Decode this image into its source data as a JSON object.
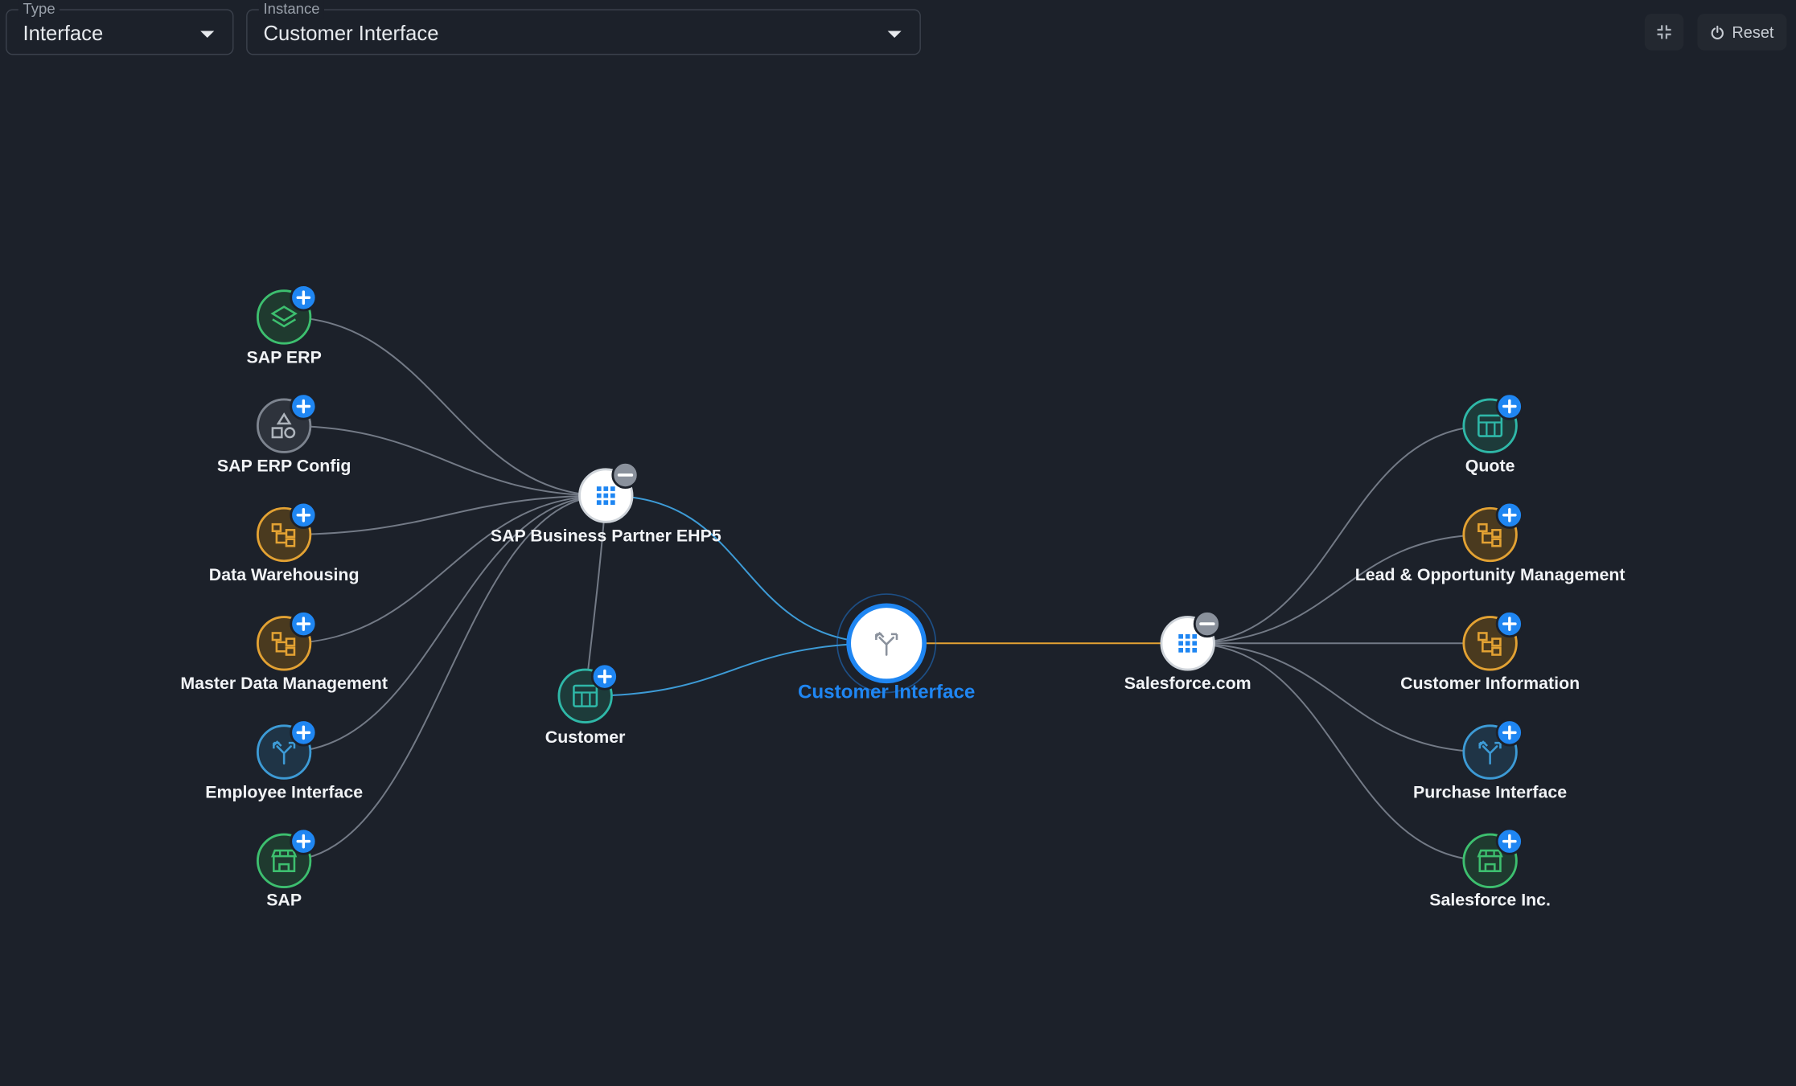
{
  "toolbar": {
    "type_label": "Type",
    "type_value": "Interface",
    "instance_label": "Instance",
    "instance_value": "Customer Interface",
    "collapse_icon": "collapse-icon",
    "reset_label": "Reset",
    "reset_icon": "power-icon"
  },
  "colors": {
    "background": "#1c212a",
    "accent": "#1f86f2",
    "edge_gray": "#737a86",
    "edge_blue": "#3d9bd6",
    "edge_orange": "#e3a233",
    "green": "#3dbf6f",
    "orange": "#e3a233",
    "teal": "#2fb8a8",
    "blue": "#3d9bd6",
    "gray": "#7d848f"
  },
  "graph": {
    "nodes": {
      "sap_erp": {
        "label": "SAP ERP",
        "icon": "layers-icon",
        "badge": "expand"
      },
      "sap_erp_config": {
        "label": "SAP ERP Config",
        "icon": "shapes-icon",
        "badge": "expand"
      },
      "data_warehousing": {
        "label": "Data Warehousing",
        "icon": "hierarchy-icon",
        "badge": "expand"
      },
      "master_data_management": {
        "label": "Master Data Management",
        "icon": "hierarchy-icon",
        "badge": "expand"
      },
      "employee_interface": {
        "label": "Employee Interface",
        "icon": "interface-icon",
        "badge": "expand"
      },
      "sap": {
        "label": "SAP",
        "icon": "store-icon",
        "badge": "expand"
      },
      "sap_business_partner": {
        "label": "SAP Business Partner EHP5",
        "icon": "grid-icon",
        "badge": "collapse"
      },
      "customer": {
        "label": "Customer",
        "icon": "table-icon",
        "badge": "expand"
      },
      "customer_interface": {
        "label": "Customer Interface",
        "icon": "interface-icon",
        "badge": "none"
      },
      "salesforce_com": {
        "label": "Salesforce.com",
        "icon": "grid-icon",
        "badge": "collapse"
      },
      "quote": {
        "label": "Quote",
        "icon": "table-icon",
        "badge": "expand"
      },
      "lead_opportunity": {
        "label": "Lead & Opportunity Management",
        "icon": "hierarchy-icon",
        "badge": "expand"
      },
      "customer_information": {
        "label": "Customer Information",
        "icon": "hierarchy-icon",
        "badge": "expand"
      },
      "purchase_interface": {
        "label": "Purchase Interface",
        "icon": "interface-icon",
        "badge": "expand"
      },
      "salesforce_inc": {
        "label": "Salesforce Inc.",
        "icon": "store-icon",
        "badge": "expand"
      }
    }
  }
}
